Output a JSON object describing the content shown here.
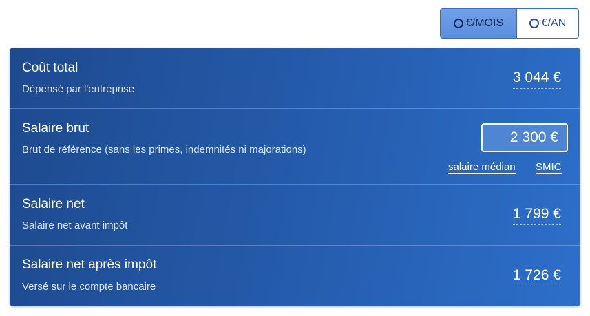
{
  "period_toggle": {
    "month_label": "€/MOIS",
    "year_label": "€/AN",
    "selected": "month"
  },
  "rows": [
    {
      "title": "Coût total",
      "subtitle": "Dépensé par l'entreprise",
      "value": "3 044 €"
    },
    {
      "title": "Salaire brut",
      "subtitle": "Brut de référence (sans les primes, indemnités ni majorations)",
      "value": "2 300 €"
    },
    {
      "title": "Salaire net",
      "subtitle": "Salaire net avant impôt",
      "value": "1 799 €"
    },
    {
      "title": "Salaire net après impôt",
      "subtitle": "Versé sur le compte bancaire",
      "value": "1 726 €"
    }
  ],
  "brut_links": {
    "median": "salaire médian",
    "smic": "SMIC"
  },
  "colors": {
    "card_gradient_start": "#1e4a8f",
    "card_gradient_end": "#2d6fca",
    "toggle_border": "#2f6fc9",
    "toggle_selected_bg": "#5b8fdf"
  }
}
